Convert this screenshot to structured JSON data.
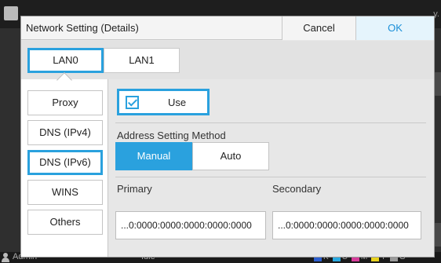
{
  "background": {
    "right_text": "y.",
    "status": {
      "user": "Admin",
      "state": "Idle",
      "inks": [
        {
          "label": "K",
          "color": "#2d5fd0"
        },
        {
          "label": "C",
          "color": "#29a9e0"
        },
        {
          "label": "M",
          "color": "#d63c9a"
        },
        {
          "label": "Y",
          "color": "#e8d21e"
        },
        {
          "label": "G",
          "color": "#9a9a9a"
        }
      ]
    }
  },
  "dialog": {
    "title": "Network Setting (Details)",
    "cancel_label": "Cancel",
    "ok_label": "OK",
    "lan_tabs": [
      {
        "label": "LAN0",
        "active": true
      },
      {
        "label": "LAN1",
        "active": false
      }
    ],
    "side_items": [
      {
        "label": "Proxy",
        "active": false
      },
      {
        "label": "DNS (IPv4)",
        "active": false
      },
      {
        "label": "DNS (IPv6)",
        "active": true
      },
      {
        "label": "WINS",
        "active": false
      },
      {
        "label": "Others",
        "active": false
      }
    ],
    "use_label": "Use",
    "use_checked": true,
    "address_method_label": "Address Setting Method",
    "method_options": [
      "Manual",
      "Auto"
    ],
    "method_selected": "Manual",
    "primary_label": "Primary",
    "primary_value": "...0:0000:0000:0000:0000:0000",
    "secondary_label": "Secondary",
    "secondary_value": "...0:0000:0000:0000:0000:0000",
    "accent_color": "#2aa1de"
  }
}
